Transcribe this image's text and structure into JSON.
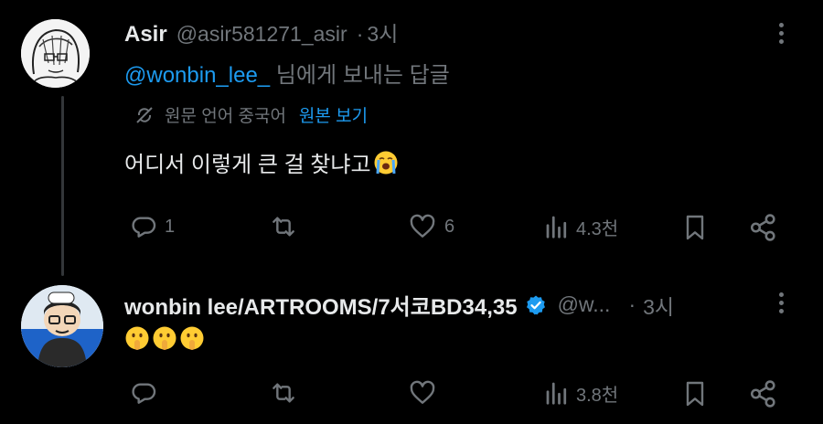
{
  "reply1": {
    "author_name": "Asir",
    "author_handle": "@asir581271_asir",
    "separator": "·",
    "time": "3시",
    "reply_to_handle": "@wonbin_lee_",
    "reply_to_suffix": " 님에게 보내는 답글",
    "translation_note": "원문 언어 중국어",
    "show_original_label": "원본 보기",
    "text": "어디서 이렇게 큰 걸 찾냐고",
    "emoji_icon": "loudly-crying-face",
    "stats": {
      "replies": "1",
      "retweets": "",
      "likes": "6",
      "views": "4.3천"
    }
  },
  "reply2": {
    "author_name": "wonbin lee/ARTROOMS/7서코BD34,35",
    "verified_icon": "verified-badge",
    "author_handle": "@w...",
    "separator": "·",
    "time": "3시",
    "emoji_icons": [
      "shushing-face",
      "shushing-face",
      "shushing-face"
    ],
    "stats": {
      "replies": "",
      "retweets": "",
      "likes": "",
      "views": "3.8천"
    }
  },
  "colors": {
    "background": "#000000",
    "text": "#e7e9ea",
    "muted": "#71767b",
    "accent": "#1d9bf0"
  }
}
